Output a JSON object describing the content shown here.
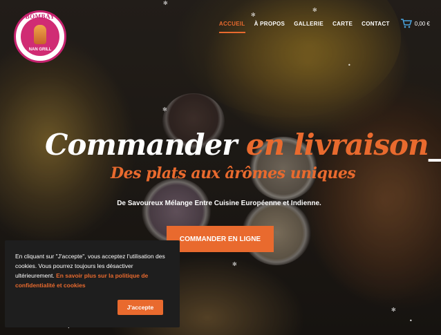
{
  "logo": {
    "top_text": "BOMBAY",
    "bottom_text": "NAN GRILL"
  },
  "nav": {
    "items": [
      {
        "label": "ACCUEIL",
        "active": true
      },
      {
        "label": "À PROPOS",
        "active": false
      },
      {
        "label": "GALLERIE",
        "active": false
      },
      {
        "label": "CARTE",
        "active": false
      },
      {
        "label": "CONTACT",
        "active": false
      }
    ],
    "cart_icon": "shopping-cart-icon",
    "cart_total": "0,00 €"
  },
  "hero": {
    "headline_white": "Commander",
    "headline_orange": "en livraison",
    "cursor": "_",
    "subheadline": "Des plats aux ârômes uniques",
    "tagline": "De Savoureux Mélange Entre Cuisine Européenne et Indienne.",
    "cta_label": "COMMANDER EN LIGNE"
  },
  "cookie": {
    "text": "En cliquant sur \"J'accepte\", vous acceptez l'utilisation des cookies. Vous pourrez toujours les désactiver ultérieurement.",
    "link_text": "En savoir plus sur la politique de confidentialité et cookies",
    "button_label": "J'accepte"
  },
  "colors": {
    "accent": "#e96a2e",
    "logo_pink": "#c7226f",
    "cookie_bg": "#1e1e1e"
  }
}
